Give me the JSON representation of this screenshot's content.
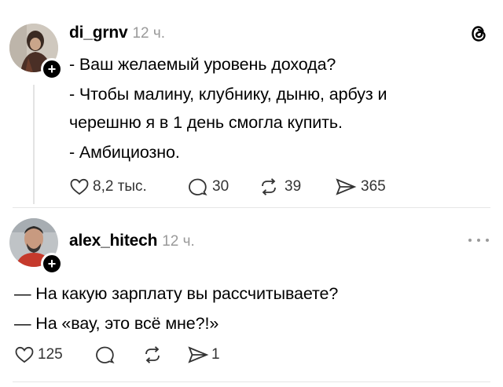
{
  "post1": {
    "username": "di_grnv",
    "time": "12 ч.",
    "lines": [
      "- Ваш желаемый уровень дохода?",
      "- Чтобы малину, клубнику, дыню, арбуз и",
      "черешню я в 1 день смогла купить.",
      "- Амбициозно."
    ],
    "likes": "8,2 тыс.",
    "comments": "30",
    "reposts": "39",
    "shares": "365"
  },
  "post2": {
    "username": "alex_hitech",
    "time": "12 ч.",
    "lines": [
      "— На какую зарплату вы рассчитываете?",
      "— На «вау, это всё мне?!»"
    ],
    "likes": "125",
    "comments": "",
    "reposts": "",
    "shares": "1"
  },
  "icons": {
    "logo": "threads-logo-icon",
    "more": "more-options-icon",
    "like": "heart-icon",
    "comment": "comment-bubble-icon",
    "repost": "repost-icon",
    "share": "share-icon",
    "follow": "plus-icon"
  },
  "colors": {
    "text": "#000000",
    "muted": "#9a9a9a",
    "icon": "#333333"
  }
}
